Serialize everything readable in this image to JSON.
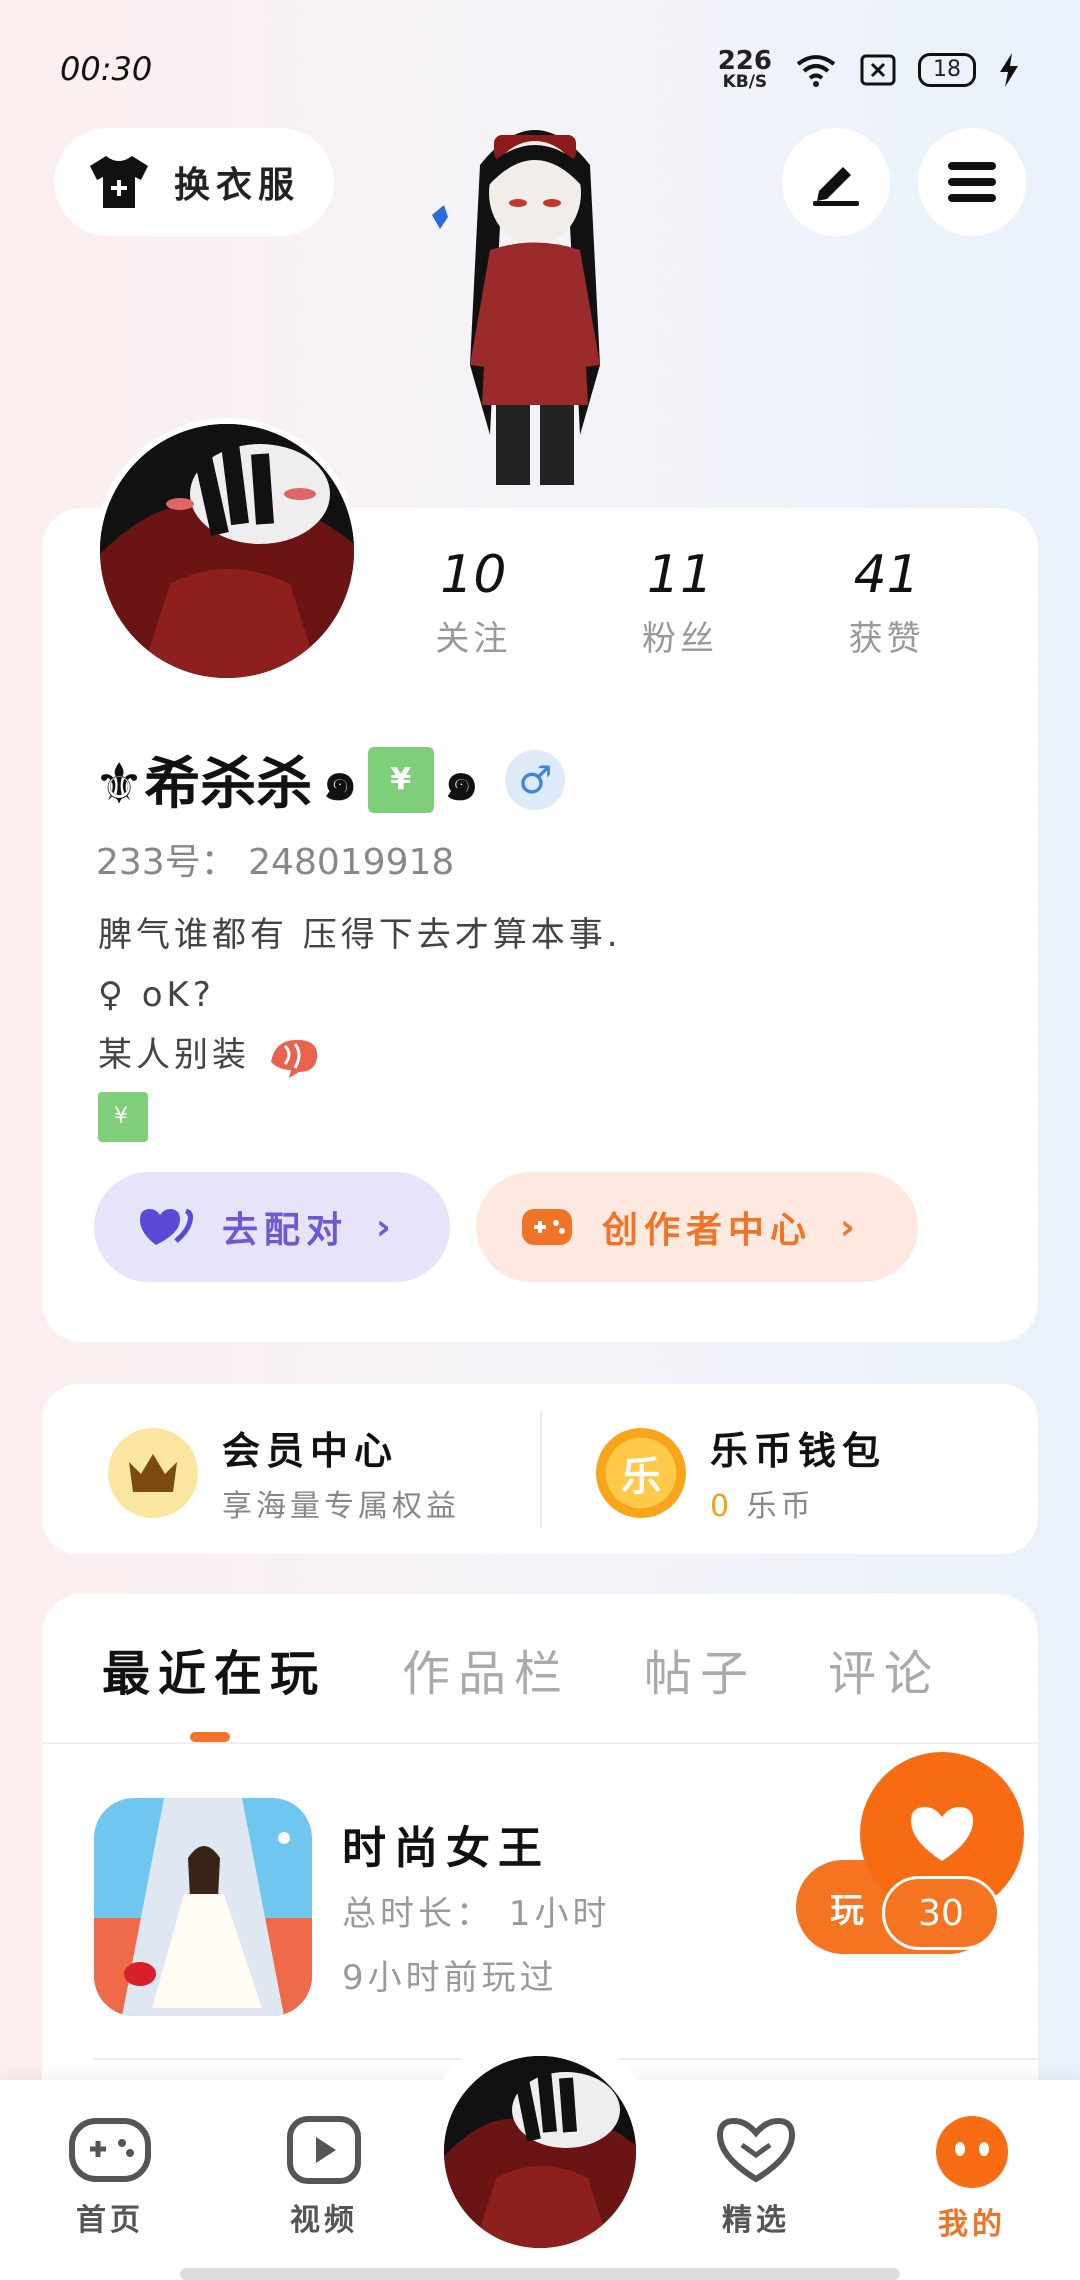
{
  "status_bar": {
    "time": "00:30",
    "net_speed_value": "226",
    "net_speed_unit": "KB/S",
    "battery": "18",
    "icons": [
      "wifi-icon",
      "sim-icon",
      "battery-icon",
      "charging-icon"
    ]
  },
  "header": {
    "outfit_label": "换衣服",
    "edit_icon": "pen-icon",
    "menu_icon": "menu-icon"
  },
  "profile": {
    "stats": [
      {
        "value": "10",
        "label": "关注"
      },
      {
        "value": "11",
        "label": "粉丝"
      },
      {
        "value": "41",
        "label": "获赞"
      }
    ],
    "nickname_prefix": "⚜希杀杀",
    "nickname_suffix_symbol": "๑",
    "emoji_text": "¥",
    "gender_symbol": "♂",
    "uid": "233号： 248019918",
    "bio_lines": [
      "脾气谁都有 压得下去才算本事.",
      "♀ oK?",
      "某人别装"
    ],
    "match_button": "去配对",
    "creator_button": "创作者中心"
  },
  "wallet": {
    "member_title": "会员中心",
    "member_sub": "享海量专属权益",
    "coin_title": "乐币钱包",
    "coin_count": "0",
    "coin_unit": "乐币",
    "coin_glyph": "乐"
  },
  "tabs": [
    "最近在玩",
    "作品栏",
    "帖子",
    "评论"
  ],
  "game": {
    "title": "时尚女王",
    "total_time": "总时长： 1小时",
    "last_played": "9小时前玩过",
    "play_button": "玩",
    "like_count": "30"
  },
  "bottom_nav": [
    {
      "label": "首页",
      "icon": "gamepad-icon"
    },
    {
      "label": "视频",
      "icon": "play-icon"
    },
    {
      "label": "精选",
      "icon": "heart-icon"
    },
    {
      "label": "我的",
      "icon": "face-icon"
    }
  ],
  "colors": {
    "accent_orange": "#f07328",
    "match_purple": "#6a5ad6",
    "gender_blue": "#3a86e0"
  }
}
